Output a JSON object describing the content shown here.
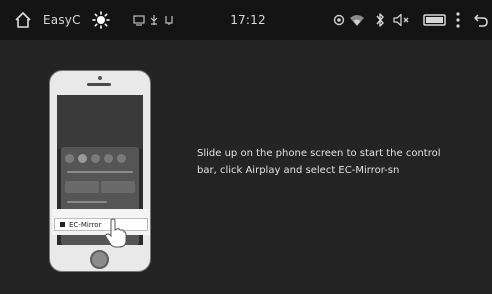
{
  "status_bar": {
    "home_icon": "home-icon",
    "app_label": "EasyC",
    "brightness_icon": "sun-icon",
    "notification_icons": [
      "screen-notification-icon",
      "usb-icon",
      "usb-icon"
    ],
    "time": "17:12",
    "right_icons": [
      "gps-icon",
      "wifi-icon",
      "bluetooth-icon",
      "volume-icon",
      "battery-icon",
      "more-vert-icon",
      "back-icon"
    ]
  },
  "illustration": {
    "phone_option_label": "EC-Mirror"
  },
  "instruction": "Slide up on the phone screen to start the control bar, click Airplay and select EC-Mirror-sn"
}
